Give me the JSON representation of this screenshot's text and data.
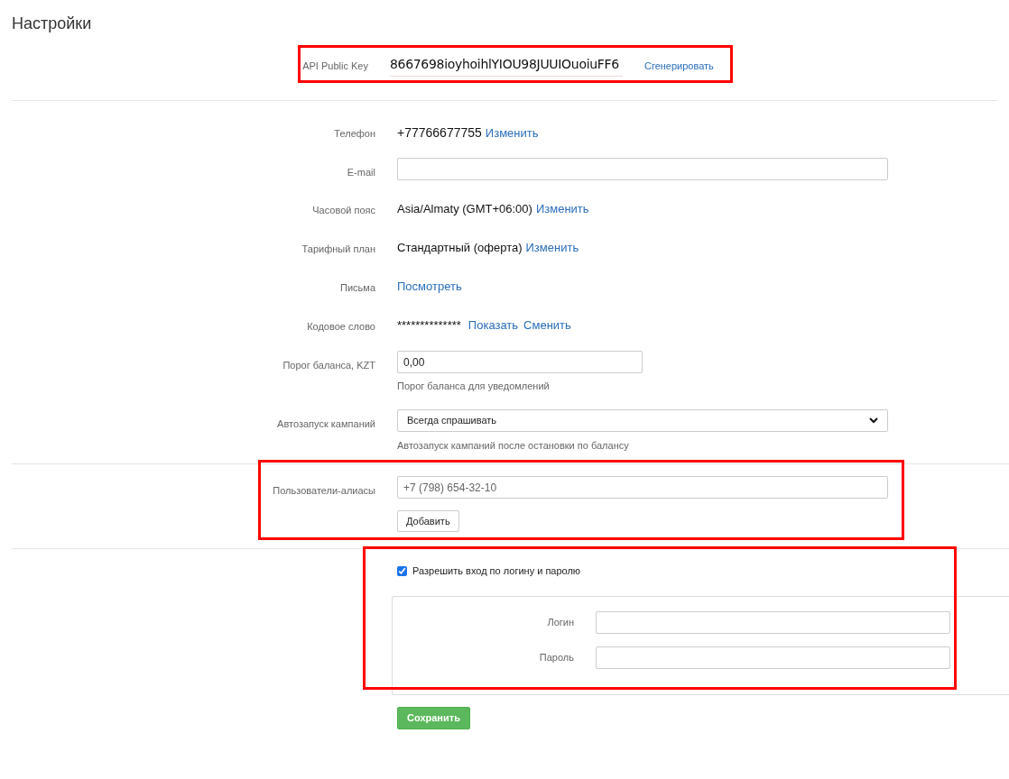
{
  "title": "Настройки",
  "api_key": {
    "label": "API Public Key",
    "value": "8667698ioyhoihlYIOU98JUUIOuoiuFF6",
    "action": "Сгенерировать",
    "highlighted": true
  },
  "fields": [
    {
      "kind": "text",
      "label": "Телефон",
      "value": "+77766677755",
      "links": [
        "Изменить"
      ]
    },
    {
      "kind": "input",
      "label": "E-mail"
    },
    {
      "kind": "text",
      "label": "Часовой пояс",
      "value": "Asia/Almaty (GMT+06:00)",
      "links": [
        "Изменить"
      ]
    },
    {
      "kind": "text",
      "label": "Тарифный план",
      "value": "Стандартный (оферта)",
      "links": [
        "Изменить"
      ]
    },
    {
      "kind": "text",
      "label": "Письма",
      "links": [
        "Посмотреть"
      ]
    },
    {
      "kind": "text",
      "label": "Кодовое слово",
      "value": "**************",
      "links": [
        "Показать",
        "Сменить"
      ]
    },
    {
      "kind": "input",
      "label": "Порог баланса, KZT",
      "value": "0,00",
      "help": "Порог баланса для уведомлений"
    },
    {
      "kind": "select",
      "label": "Автозапуск кампаний",
      "value": "Всегда спрашивать",
      "help": "Автозапуск кампаний после остановки по балансу"
    }
  ],
  "aliases": {
    "label": "Пользователи-алиасы",
    "placeholder": "+7 (798) 654-32-10",
    "button": "Добавить",
    "highlighted": true
  },
  "login": {
    "checkbox": {
      "label": "Разрешить вход по логину и паролю",
      "checked": true
    },
    "fields": [
      {
        "label": "Логин"
      },
      {
        "label": "Пароль"
      }
    ],
    "highlighted": true
  },
  "save": "Сохранить"
}
